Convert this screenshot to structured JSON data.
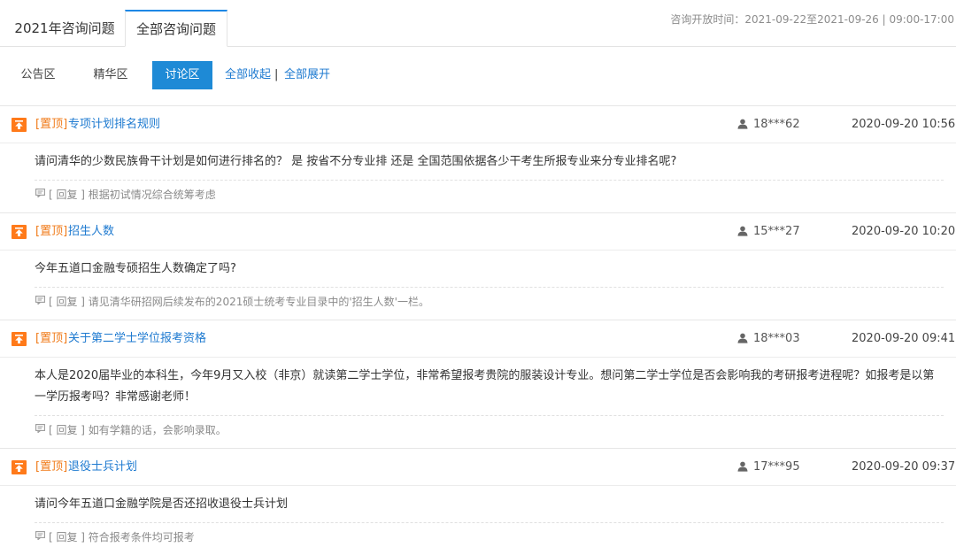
{
  "top_tabs": [
    {
      "label": "2021年咨询问题"
    },
    {
      "label": "全部咨询问题"
    }
  ],
  "notice": "咨询开放时间：2021-09-22至2021-09-26 | 09:00-17:00",
  "sub_tabs": [
    {
      "label": "公告区"
    },
    {
      "label": "精华区"
    },
    {
      "label": "讨论区"
    }
  ],
  "actions": {
    "collapse_all": "全部收起",
    "separator": "|",
    "expand_all": "全部展开"
  },
  "items": [
    {
      "tag": "[置顶]",
      "title": "专项计划排名规则",
      "user": "18***62",
      "date": "2020-09-20 10:56",
      "question": "请问清华的少数民族骨干计划是如何进行排名的？ 是 按省不分专业排 还是 全国范围依据各少干考生所报专业来分专业排名呢?",
      "reply": "[ 回复 ] 根据初试情况综合统筹考虑"
    },
    {
      "tag": "[置顶]",
      "title": "招生人数",
      "user": "15***27",
      "date": "2020-09-20 10:20",
      "question": "今年五道口金融专硕招生人数确定了吗?",
      "reply": "[ 回复 ] 请见清华研招网后续发布的2021硕士统考专业目录中的'招生人数'一栏。"
    },
    {
      "tag": "[置顶]",
      "title": "关于第二学士学位报考资格",
      "user": "18***03",
      "date": "2020-09-20 09:41",
      "question": "本人是2020届毕业的本科生，今年9月又入校（非京）就读第二学士学位，非常希望报考贵院的服装设计专业。想问第二学士学位是否会影响我的考研报考进程呢？如报考是以第一学历报考吗？非常感谢老师！",
      "reply": "[ 回复 ] 如有学籍的话，会影响录取。"
    },
    {
      "tag": "[置顶]",
      "title": "退役士兵计划",
      "user": "17***95",
      "date": "2020-09-20 09:37",
      "question": "请问今年五道口金融学院是否还招收退役士兵计划",
      "reply": "[ 回复 ] 符合报考条件均可报考"
    }
  ]
}
